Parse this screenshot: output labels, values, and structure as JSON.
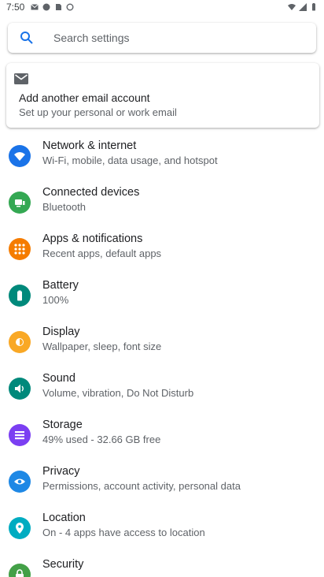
{
  "status": {
    "time": "7:50"
  },
  "search": {
    "placeholder": "Search settings"
  },
  "account_card": {
    "title": "Add another email account",
    "subtitle": "Set up your personal or work email"
  },
  "settings": [
    {
      "title": "Network & internet",
      "subtitle": "Wi-Fi, mobile, data usage, and hotspot",
      "icon": "wifi-icon",
      "color": "#1a73e8"
    },
    {
      "title": "Connected devices",
      "subtitle": "Bluetooth",
      "icon": "devices-icon",
      "color": "#34a853"
    },
    {
      "title": "Apps & notifications",
      "subtitle": "Recent apps, default apps",
      "icon": "apps-icon",
      "color": "#f57c00"
    },
    {
      "title": "Battery",
      "subtitle": "100%",
      "icon": "battery-icon",
      "color": "#00897b"
    },
    {
      "title": "Display",
      "subtitle": "Wallpaper, sleep, font size",
      "icon": "brightness-icon",
      "color": "#f9a825"
    },
    {
      "title": "Sound",
      "subtitle": "Volume, vibration, Do Not Disturb",
      "icon": "volume-icon",
      "color": "#00897b"
    },
    {
      "title": "Storage",
      "subtitle": "49% used - 32.66 GB free",
      "icon": "storage-icon",
      "color": "#7b3ff2"
    },
    {
      "title": "Privacy",
      "subtitle": "Permissions, account activity, personal data",
      "icon": "privacy-icon",
      "color": "#1e88e5"
    },
    {
      "title": "Location",
      "subtitle": "On - 4 apps have access to location",
      "icon": "location-icon",
      "color": "#00acc1"
    },
    {
      "title": "Security",
      "subtitle": "",
      "icon": "security-icon",
      "color": "#43a047"
    }
  ]
}
